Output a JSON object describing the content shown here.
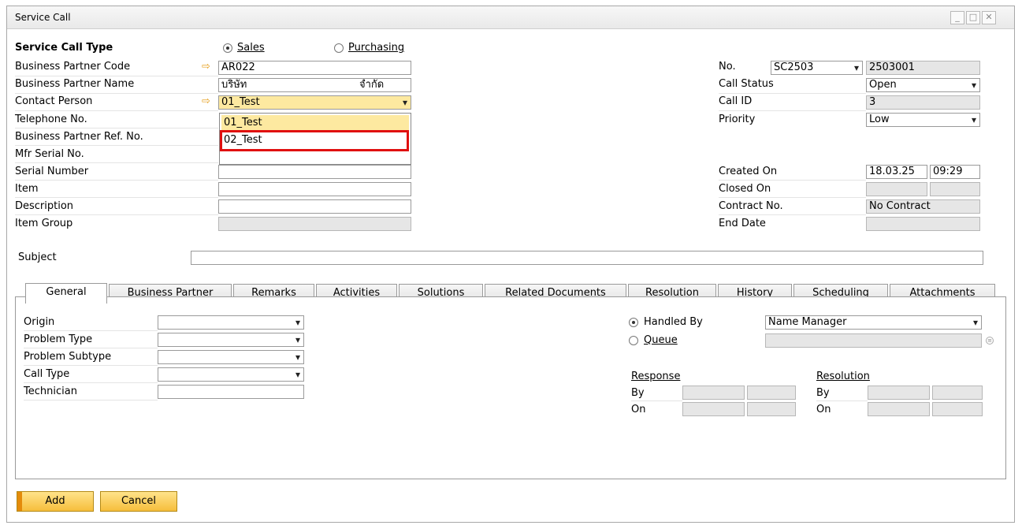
{
  "window": {
    "title": "Service Call"
  },
  "header": {
    "service_call_type_label": "Service Call Type",
    "type_sales": "Sales",
    "type_purchasing": "Purchasing",
    "bp_code_label": "Business Partner Code",
    "bp_code_value": "AR022",
    "bp_name_label": "Business Partner Name",
    "bp_name_value_1": "บริษัท",
    "bp_name_value_2": "จำกัด",
    "contact_label": "Contact Person",
    "contact_value": "01_Test",
    "telephone_label": "Telephone No.",
    "bp_ref_label": "Business Partner Ref. No.",
    "mfr_serial_label": "Mfr Serial No.",
    "serial_label": "Serial Number",
    "item_label": "Item",
    "description_label": "Description",
    "item_group_label": "Item Group",
    "subject_label": "Subject"
  },
  "contact_dropdown": {
    "options": [
      "01_Test",
      "02_Test"
    ]
  },
  "right": {
    "no_label": "No.",
    "series_value": "SC2503",
    "number_value": "2503001",
    "call_status_label": "Call Status",
    "call_status_value": "Open",
    "call_id_label": "Call ID",
    "call_id_value": "3",
    "priority_label": "Priority",
    "priority_value": "Low",
    "created_on_label": "Created On",
    "created_date": "18.03.25",
    "created_time": "09:29",
    "closed_on_label": "Closed On",
    "contract_no_label": "Contract No.",
    "contract_no_value": "No Contract",
    "end_date_label": "End Date"
  },
  "tabs": [
    "General",
    "Business Partner",
    "Remarks",
    "Activities",
    "Solutions",
    "Related Documents",
    "Resolution",
    "History",
    "Scheduling",
    "Attachments"
  ],
  "general": {
    "origin_label": "Origin",
    "problem_type_label": "Problem Type",
    "problem_subtype_label": "Problem Subtype",
    "call_type_label": "Call Type",
    "technician_label": "Technician",
    "handled_by_label": "Handled By",
    "handled_by_value": "Name Manager",
    "queue_label": "Queue",
    "response_label": "Response",
    "resolution_label": "Resolution",
    "by_label": "By",
    "on_label": "On"
  },
  "buttons": {
    "add": "Add",
    "cancel": "Cancel"
  }
}
